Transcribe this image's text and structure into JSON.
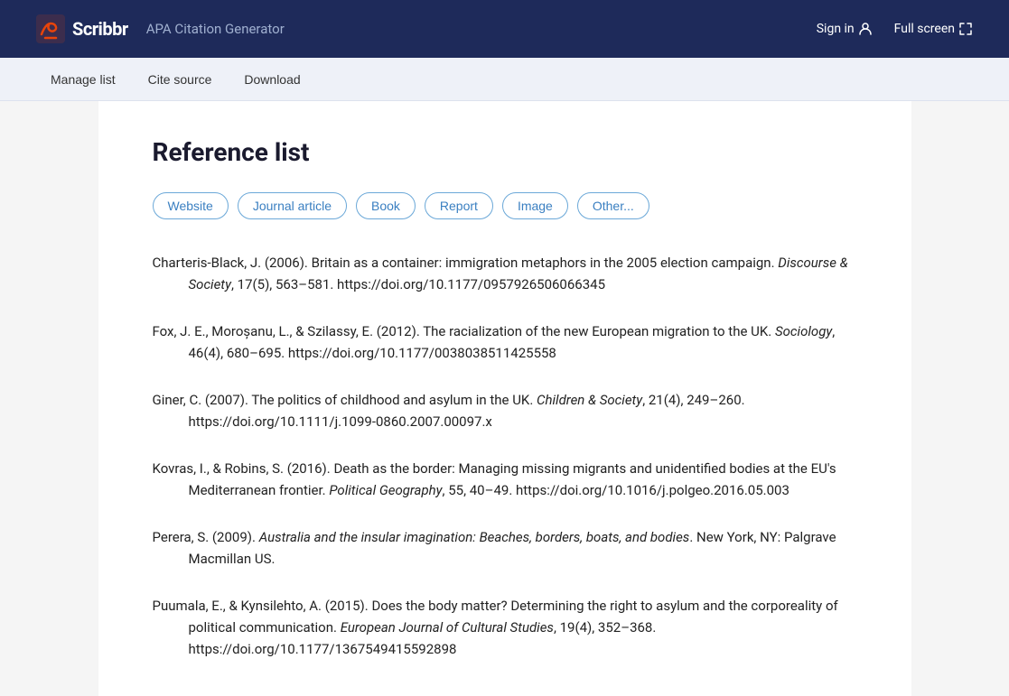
{
  "header": {
    "logo_text": "Scribbr",
    "subtitle": "APA Citation Generator",
    "sign_in": "Sign in",
    "full_screen": "Full screen"
  },
  "toolbar": {
    "manage_list": "Manage list",
    "cite_source": "Cite source",
    "download": "Download"
  },
  "main": {
    "page_title": "Reference list",
    "source_types": [
      "Website",
      "Journal article",
      "Book",
      "Report",
      "Image",
      "Other..."
    ],
    "references": [
      {
        "id": "ref1",
        "text": "Charteris-Black, J. (2006). Britain as a container: immigration metaphors in the 2005 election campaign. ",
        "italic_part": "Discourse & Society",
        "post_italic": ", 17(5), 563–581. https://doi.org/10.1177/0957926506066345"
      },
      {
        "id": "ref2",
        "text": "Fox, J. E., Moroșanu, L., & Szilassy, E. (2012). The racialization of the new European migration to the UK. ",
        "italic_part": "Sociology",
        "post_italic": ", 46(4), 680–695. https://doi.org/10.1177/0038038511425558"
      },
      {
        "id": "ref3",
        "text": "Giner, C. (2007). The politics of childhood and asylum in the UK. ",
        "italic_part": "Children & Society",
        "post_italic": ", 21(4), 249–260. https://doi.org/10.1111/j.1099-0860.2007.00097.x"
      },
      {
        "id": "ref4",
        "text": "Kovras, I., & Robins, S. (2016). Death as the border: Managing missing migrants and unidentified bodies at the EU's Mediterranean frontier. ",
        "italic_part": "Political Geography",
        "post_italic": ", 55, 40–49. https://doi.org/10.1016/j.polgeo.2016.05.003"
      },
      {
        "id": "ref5",
        "text": "Perera, S. (2009). ",
        "italic_part": "Australia and the insular imagination: Beaches, borders, boats, and bodies",
        "post_italic": ". New York, NY: Palgrave Macmillan US."
      },
      {
        "id": "ref6",
        "text": "Puumala, E., & Kynsilehto, A. (2015). Does the body matter? Determining the right to asylum and the corporeality of political communication. ",
        "italic_part": "European Journal of Cultural Studies",
        "post_italic": ", 19(4), 352–368. https://doi.org/10.1177/1367549415592898"
      }
    ]
  }
}
